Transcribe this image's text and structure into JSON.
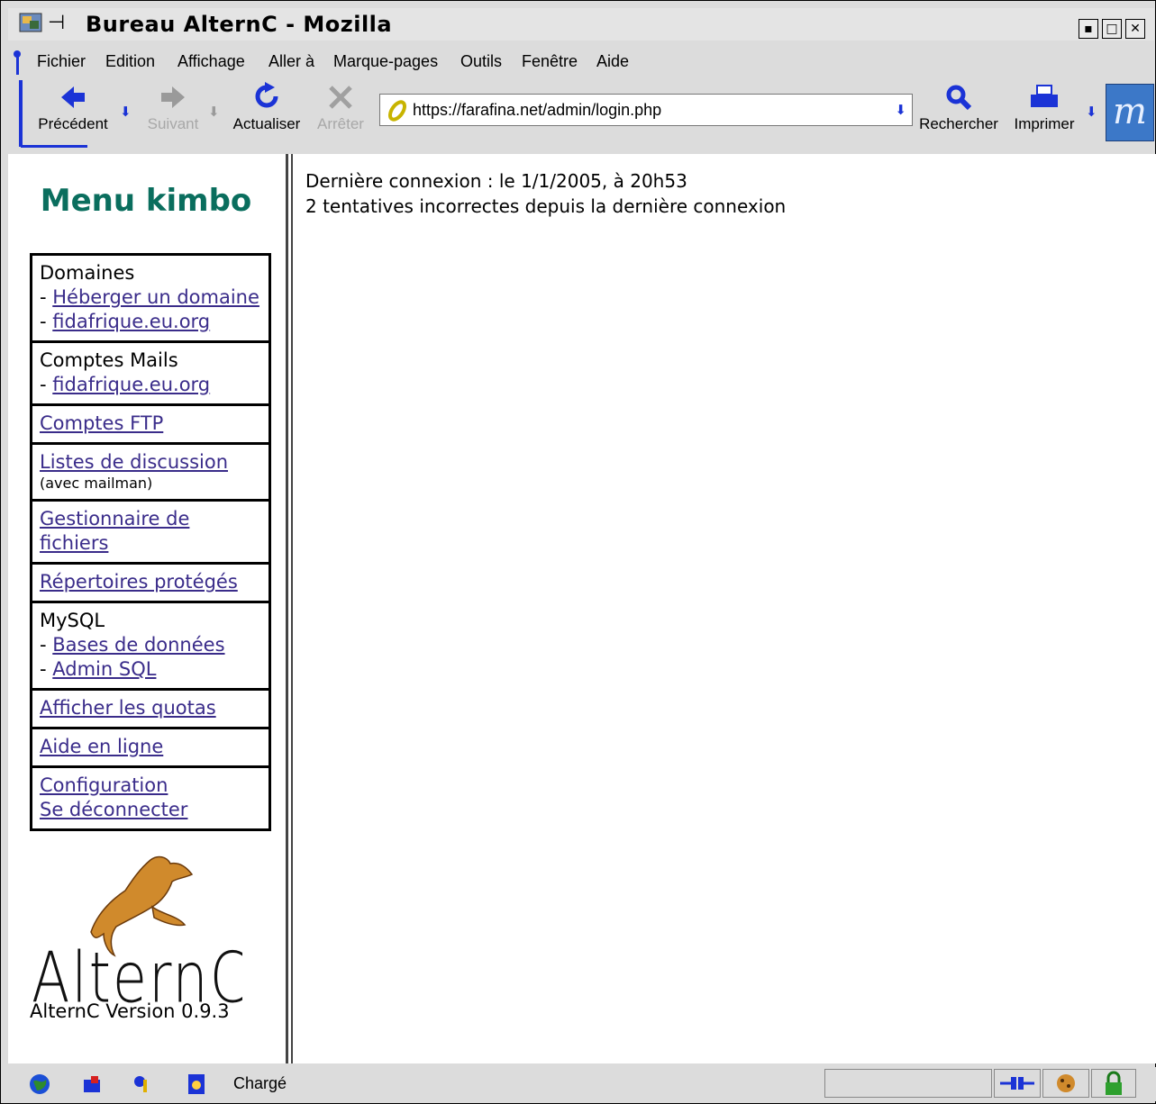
{
  "window": {
    "title": "Bureau AlternC - Mozilla",
    "pin_glyph": "⊣⊏",
    "controls": [
      "▪",
      "□",
      "✕"
    ]
  },
  "menubar": [
    "Fichier",
    "Edition",
    "Affichage",
    "Aller à",
    "Marque-pages",
    "Outils",
    "Fenêtre",
    "Aide"
  ],
  "toolbar": {
    "back": "Précédent",
    "forward": "Suivant",
    "reload": "Actualiser",
    "stop": "Arrêter",
    "url": "https://farafina.net/admin/login.php",
    "search": "Rechercher",
    "print": "Imprimer"
  },
  "sidebar": {
    "title": "Menu kimbo",
    "domaines": {
      "label": "Domaines",
      "links": [
        "Héberger un domaine",
        "fidafrique.eu.org"
      ]
    },
    "mails": {
      "label": "Comptes Mails",
      "links": [
        "fidafrique.eu.org"
      ]
    },
    "ftp": "Comptes FTP",
    "listes": {
      "link": "Listes de discussion",
      "note": "(avec mailman)"
    },
    "fichiers": "Gestionnaire de fichiers",
    "repertoires": "Répertoires protégés",
    "mysql": {
      "label": "MySQL",
      "links": [
        "Bases de données",
        "Admin SQL"
      ]
    },
    "quotas": "Afficher les quotas",
    "aide": "Aide en ligne",
    "config": "Configuration",
    "logout": "Se déconnecter",
    "logo_text": "AlternC",
    "version": "AlternC Version 0.9.3"
  },
  "main": {
    "line1": "Dernière connexion : le 1/1/2005, à 20h53",
    "line2": "2 tentatives incorrectes depuis la dernière connexion"
  },
  "status": {
    "text": "Chargé",
    "dash": "-"
  },
  "colors": {
    "menu_title": "#0a6e5e",
    "link": "#3a2c8a",
    "accent_blue": "#1b33d6",
    "kangaroo": "#d08a2c"
  }
}
